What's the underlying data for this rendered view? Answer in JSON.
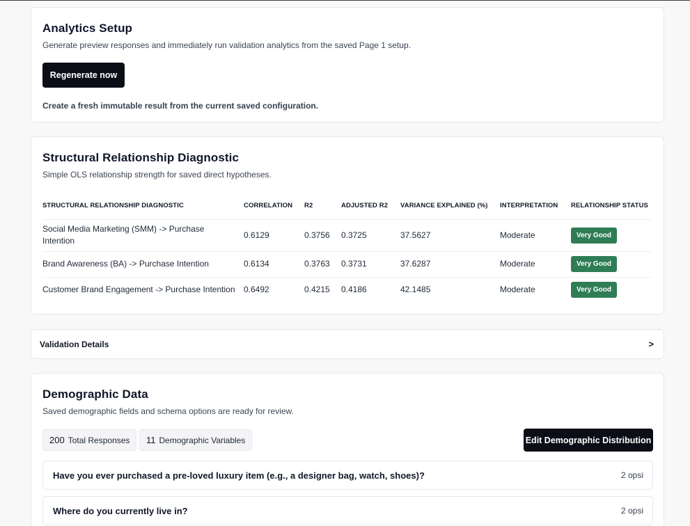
{
  "analytics": {
    "title": "Analytics Setup",
    "subtitle": "Generate preview responses and immediately run validation analytics from the saved Page 1 setup.",
    "button": "Regenerate now",
    "note": "Create a fresh immutable result from the current saved configuration."
  },
  "structural": {
    "title": "Structural Relationship Diagnostic",
    "subtitle": "Simple OLS relationship strength for saved direct hypotheses.",
    "columns": [
      "STRUCTURAL RELATIONSHIP DIAGNOSTIC",
      "CORRELATION",
      "R2",
      "ADJUSTED R2",
      "VARIANCE EXPLAINED (%)",
      "INTERPRETATION",
      "RELATIONSHIP STATUS"
    ],
    "rows": [
      [
        "Social Media Marketing (SMM) -> Purchase Intention",
        "0.6129",
        "0.3756",
        "0.3725",
        "37.5627",
        "Moderate",
        "Very Good"
      ],
      [
        "Brand Awareness (BA) -> Purchase Intention",
        "0.6134",
        "0.3763",
        "0.3731",
        "37.6287",
        "Moderate",
        "Very Good"
      ],
      [
        "Customer Brand Engagement -> Purchase Intention",
        "0.6492",
        "0.4215",
        "0.4186",
        "42.1485",
        "Moderate",
        "Very Good"
      ]
    ],
    "status_color": "#2f7d55"
  },
  "validation": {
    "label": "Validation Details",
    "chevron": ">"
  },
  "demographic": {
    "title": "Demographic Data",
    "subtitle": "Saved demographic fields and schema options are ready for review.",
    "stats": [
      {
        "value": "200",
        "label": "Total Responses"
      },
      {
        "value": "11",
        "label": "Demographic Variables"
      }
    ],
    "edit_button": "Edit Demographic Distribution",
    "questions": [
      {
        "text": "Have you ever purchased a pre-loved luxury item (e.g., a designer bag, watch, shoes)?",
        "options": "2 opsi"
      },
      {
        "text": "Where do you currently live in?",
        "options": "2 opsi"
      }
    ]
  }
}
